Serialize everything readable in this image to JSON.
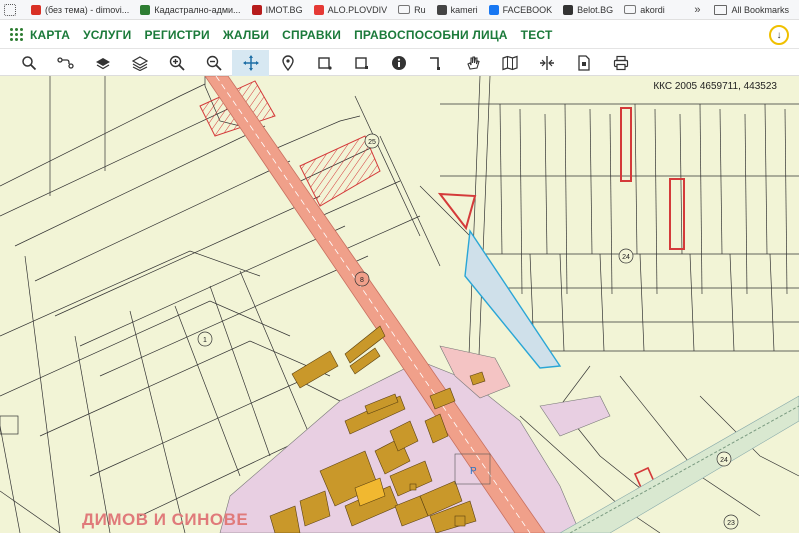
{
  "bookmarks": [
    {
      "label": "",
      "icon": "apps-grid-icon",
      "color": "#555555"
    },
    {
      "label": "(без тема) - dimovi...",
      "icon": "gmail-icon",
      "color": "#d93025"
    },
    {
      "label": "Кадастрално-адми...",
      "icon": "cadastre-icon",
      "color": "#2e7d32"
    },
    {
      "label": "IMOT.BG",
      "icon": "imot-icon",
      "color": "#b71c1c"
    },
    {
      "label": "ALO.PLOVDIV",
      "icon": "alo-icon",
      "color": "#e53935"
    },
    {
      "label": "Ru",
      "icon": "folder-icon",
      "color": "#777777"
    },
    {
      "label": "kameri",
      "icon": "globe-icon",
      "color": "#444444"
    },
    {
      "label": "FACEBOOK",
      "icon": "facebook-icon",
      "color": "#1877f2"
    },
    {
      "label": "Belot.BG",
      "icon": "belot-icon",
      "color": "#333333"
    },
    {
      "label": "akordi",
      "icon": "folder-icon",
      "color": "#777777"
    }
  ],
  "bookmarks_more": "»",
  "all_bookmarks": "All Bookmarks",
  "menu": {
    "items": [
      "КАРТА",
      "УСЛУГИ",
      "РЕГИСТРИ",
      "ЖАЛБИ",
      "СПРАВКИ",
      "ПРАВОСПОСОБНИ ЛИЦА",
      "ТЕСТ"
    ],
    "accent": "#1b7a3a",
    "download_symbol": "↓"
  },
  "tools": [
    {
      "name": "search-tool",
      "icon": "search-icon"
    },
    {
      "name": "route-tool",
      "icon": "route-icon"
    },
    {
      "name": "layers-tool",
      "icon": "layers-icon"
    },
    {
      "name": "layers-stack-tool",
      "icon": "layers-stack-icon"
    },
    {
      "name": "zoom-in-tool",
      "icon": "zoom-in-icon"
    },
    {
      "name": "zoom-out-tool",
      "icon": "zoom-out-icon"
    },
    {
      "name": "pan-tool",
      "icon": "pan-icon",
      "active": true
    },
    {
      "name": "location-tool",
      "icon": "location-pin-icon"
    },
    {
      "name": "draw-rect-tool",
      "icon": "draw-rect-icon"
    },
    {
      "name": "select-rect-tool",
      "icon": "select-rect-icon"
    },
    {
      "name": "info-tool",
      "icon": "info-icon"
    },
    {
      "name": "measure-tool",
      "icon": "measure-icon"
    },
    {
      "name": "hand-tool",
      "icon": "hand-icon"
    },
    {
      "name": "map-tool",
      "icon": "map-icon"
    },
    {
      "name": "split-tool",
      "icon": "split-icon"
    },
    {
      "name": "file-tool",
      "icon": "file-icon"
    },
    {
      "name": "print-tool",
      "icon": "print-icon"
    }
  ],
  "map": {
    "coords": "ККС 2005 4659711, 443523",
    "owner_label": "ДИМОВ И СИНОВЕ",
    "road_labels": [
      "25",
      "8",
      "1",
      "24",
      "24",
      "23"
    ],
    "parking_label": "P",
    "colors": {
      "background": "#f2f4d6",
      "road": "#f0a08a",
      "buildings": "#c9982a",
      "urban": "#e8cfe2",
      "highlight": "#cfe0ea",
      "parcel_outline": "#d43a3a"
    }
  }
}
